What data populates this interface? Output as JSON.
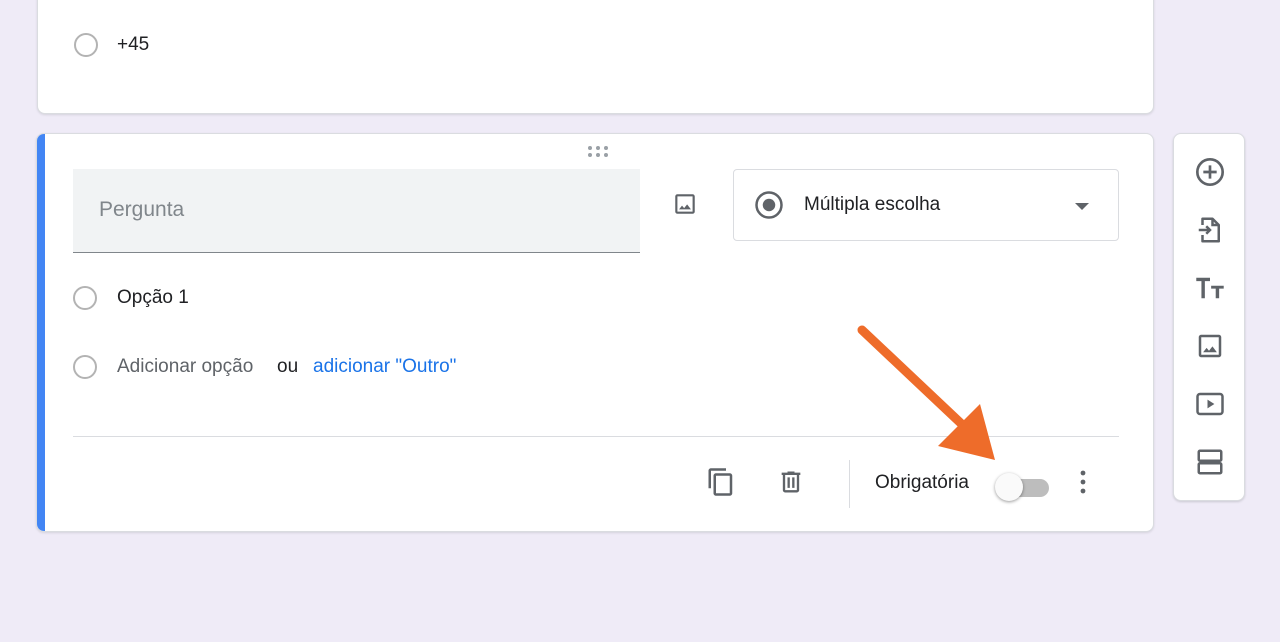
{
  "previous_question": {
    "options": [
      "+45"
    ]
  },
  "question": {
    "title_placeholder": "Pergunta",
    "type_label": "Múltipla escolha",
    "options": [
      "Opção 1"
    ],
    "add_option_label": "Adicionar opção",
    "or_label": "ou",
    "add_other_label": "adicionar \"Outro\"",
    "required_label": "Obrigatória",
    "required": false
  },
  "icons": {
    "drag": "drag-handle-icon",
    "image": "image-icon",
    "type_radio": "radio-checked-icon",
    "dropdown": "dropdown-arrow-icon",
    "duplicate": "copy-icon",
    "delete": "trash-icon",
    "more": "more-vert-icon"
  },
  "side_toolbar": [
    {
      "name": "add-question",
      "icon": "add-circle-icon"
    },
    {
      "name": "import-questions",
      "icon": "import-icon"
    },
    {
      "name": "add-title-description",
      "icon": "title-icon"
    },
    {
      "name": "add-image",
      "icon": "image-icon"
    },
    {
      "name": "add-video",
      "icon": "video-icon"
    },
    {
      "name": "add-section",
      "icon": "section-icon"
    }
  ],
  "colors": {
    "background": "#efebf7",
    "accent": "#4285f4",
    "link": "#1a73e8",
    "annotation_arrow": "#ee6c2a"
  }
}
